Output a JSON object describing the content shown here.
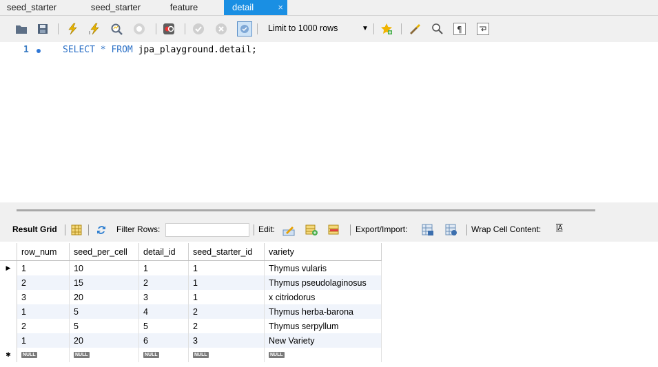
{
  "tabs": [
    {
      "label": "seed_starter"
    },
    {
      "label": "seed_starter"
    },
    {
      "label": "feature"
    },
    {
      "label": "detail",
      "close": "×"
    }
  ],
  "toolbar": {
    "limit_label": "Limit to 1000 rows",
    "icons": [
      "open-folder-icon",
      "save-icon",
      "execute-icon",
      "execute-current-icon",
      "explain-icon",
      "stop-icon",
      "stop-on-error-icon",
      "commit-icon",
      "rollback-icon",
      "autocommit-icon",
      "limit-dropdown",
      "bookmark-icon",
      "beautify-icon",
      "find-icon",
      "invisible-chars-icon",
      "wrap-icon"
    ]
  },
  "editor": {
    "line_number": "1",
    "kw1": "SELECT",
    "star": "*",
    "kw2": "FROM",
    "rest": "jpa_playground.detail;"
  },
  "result": {
    "grid_label": "Result Grid",
    "filter_label": "Filter Rows:",
    "filter_value": "",
    "edit_label": "Edit:",
    "export_label": "Export/Import:",
    "wrap_label": "Wrap Cell Content:",
    "wrap_icon_text": "IA"
  },
  "grid": {
    "columns": [
      "row_num",
      "seed_per_cell",
      "detail_id",
      "seed_starter_id",
      "variety"
    ],
    "rows": [
      [
        "1",
        "10",
        "1",
        "1",
        "Thymus vularis"
      ],
      [
        "2",
        "15",
        "2",
        "1",
        "Thymus pseudolaginosus"
      ],
      [
        "3",
        "20",
        "3",
        "1",
        "x citriodorus"
      ],
      [
        "1",
        "5",
        "4",
        "2",
        "Thymus herba-barona"
      ],
      [
        "2",
        "5",
        "5",
        "2",
        "Thymus serpyllum"
      ],
      [
        "1",
        "20",
        "6",
        "3",
        "New Variety"
      ]
    ],
    "null_text": "NULL",
    "current_marker": "▶",
    "new_marker": "✱"
  }
}
